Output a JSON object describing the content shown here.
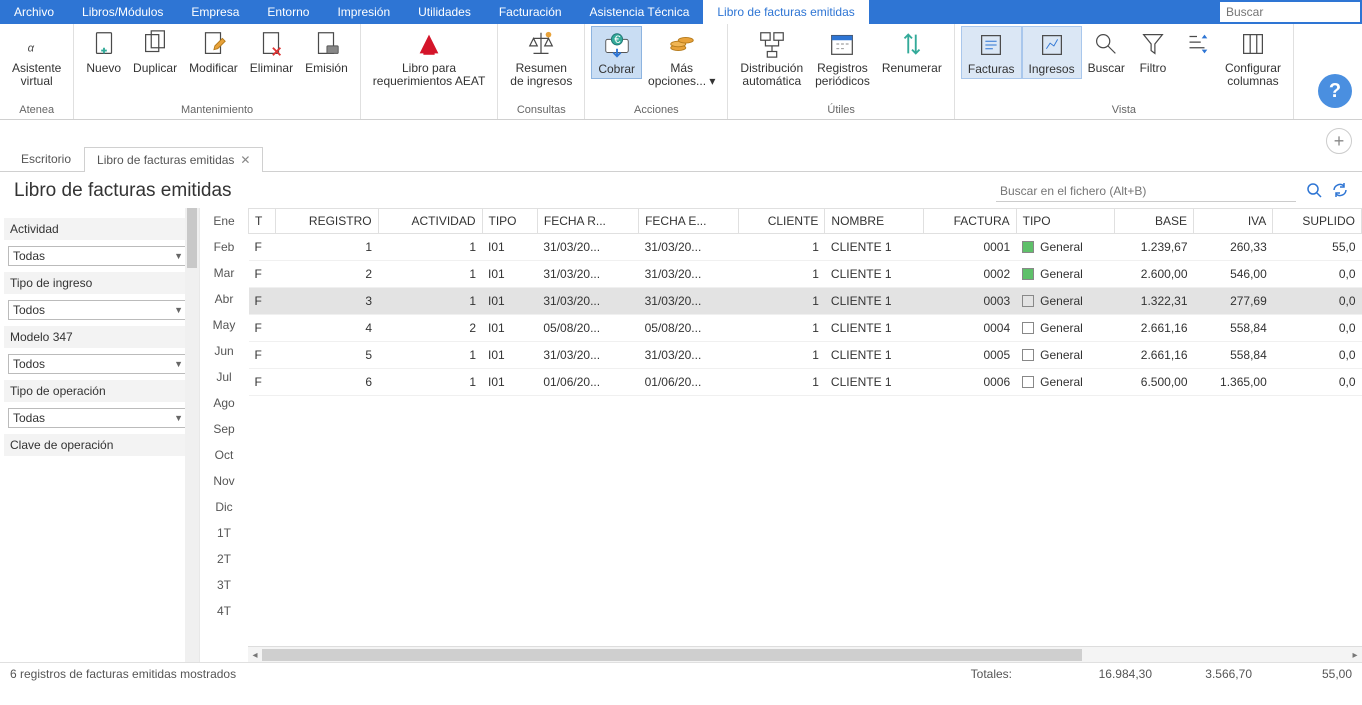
{
  "menu": {
    "items": [
      "Archivo",
      "Libros/Módulos",
      "Empresa",
      "Entorno",
      "Impresión",
      "Utilidades",
      "Facturación",
      "Asistencia Técnica",
      "Libro de facturas emitidas"
    ],
    "active": 8,
    "search_placeholder": "Buscar"
  },
  "ribbon": {
    "groups": [
      {
        "title": "Atenea",
        "buttons": [
          {
            "label": "Asistente\nvirtual",
            "icon": "alpha"
          }
        ]
      },
      {
        "title": "Mantenimiento",
        "buttons": [
          {
            "label": "Nuevo",
            "icon": "doc-plus"
          },
          {
            "label": "Duplicar",
            "icon": "doc-dup"
          },
          {
            "label": "Modificar",
            "icon": "doc-edit"
          },
          {
            "label": "Eliminar",
            "icon": "doc-del"
          },
          {
            "label": "Emisión",
            "icon": "doc-print"
          }
        ]
      },
      {
        "title": "",
        "buttons": [
          {
            "label": "Libro para\nrequerimientos AEAT",
            "icon": "aeat"
          }
        ]
      },
      {
        "title": "Consultas",
        "buttons": [
          {
            "label": "Resumen\nde ingresos",
            "icon": "scales"
          }
        ]
      },
      {
        "title": "Acciones",
        "buttons": [
          {
            "label": "Cobrar",
            "icon": "pay",
            "hl": true
          },
          {
            "label": "Más\nopciones... ▾",
            "icon": "coins"
          }
        ]
      },
      {
        "title": "Útiles",
        "buttons": [
          {
            "label": "Distribución\nautomática",
            "icon": "dist"
          },
          {
            "label": "Registros\nperiódicos",
            "icon": "cal"
          },
          {
            "label": "Renumerar",
            "icon": "renum"
          }
        ]
      },
      {
        "title": "Vista",
        "buttons": [
          {
            "label": "Facturas",
            "icon": "inv",
            "sel": true
          },
          {
            "label": "Ingresos",
            "icon": "inc",
            "sel": true
          },
          {
            "label": "Buscar",
            "icon": "find"
          },
          {
            "label": "Filtro",
            "icon": "filter"
          },
          {
            "label": "",
            "icon": "sort"
          },
          {
            "label": "Configurar\ncolumnas",
            "icon": "cols"
          }
        ]
      }
    ]
  },
  "tabs": [
    {
      "label": "Escritorio"
    },
    {
      "label": "Libro de facturas emitidas",
      "close": true,
      "active": true
    }
  ],
  "page": {
    "title": "Libro de facturas emitidas",
    "search_placeholder": "Buscar en el fichero (Alt+B)"
  },
  "filters": [
    {
      "label": "Actividad",
      "value": "Todas"
    },
    {
      "label": "Tipo de ingreso",
      "value": "Todos"
    },
    {
      "label": "Modelo 347",
      "value": "Todos"
    },
    {
      "label": "Tipo de operación",
      "value": "Todas"
    },
    {
      "label": "Clave de operación",
      "value": ""
    }
  ],
  "months": [
    "Ene",
    "Feb",
    "Mar",
    "Abr",
    "May",
    "Jun",
    "Jul",
    "Ago",
    "Sep",
    "Oct",
    "Nov",
    "Dic",
    "1T",
    "2T",
    "3T",
    "4T"
  ],
  "grid": {
    "columns": [
      "T",
      "REGISTRO",
      "ACTIVIDAD",
      "TIPO",
      "FECHA R...",
      "FECHA E...",
      "CLIENTE",
      "NOMBRE",
      "FACTURA",
      "TIPO",
      "BASE",
      "IVA",
      "SUPLIDO"
    ],
    "rows": [
      {
        "t": "F",
        "reg": "1",
        "act": "1",
        "tipo": "I01",
        "fr": "31/03/20...",
        "fe": "31/03/20...",
        "cli": "1",
        "nom": "CLIENTE 1",
        "fac": "0001",
        "tt": "General",
        "tg": true,
        "base": "1.239,67",
        "iva": "260,33",
        "sup": "55,0"
      },
      {
        "t": "F",
        "reg": "2",
        "act": "1",
        "tipo": "I01",
        "fr": "31/03/20...",
        "fe": "31/03/20...",
        "cli": "1",
        "nom": "CLIENTE 1",
        "fac": "0002",
        "tt": "General",
        "tg": true,
        "base": "2.600,00",
        "iva": "546,00",
        "sup": "0,0"
      },
      {
        "t": "F",
        "reg": "3",
        "act": "1",
        "tipo": "I01",
        "fr": "31/03/20...",
        "fe": "31/03/20...",
        "cli": "1",
        "nom": "CLIENTE 1",
        "fac": "0003",
        "tt": "General",
        "tg": false,
        "base": "1.322,31",
        "iva": "277,69",
        "sup": "0,0",
        "sel": true
      },
      {
        "t": "F",
        "reg": "4",
        "act": "2",
        "tipo": "I01",
        "fr": "05/08/20...",
        "fe": "05/08/20...",
        "cli": "1",
        "nom": "CLIENTE 1",
        "fac": "0004",
        "tt": "General",
        "tg": false,
        "base": "2.661,16",
        "iva": "558,84",
        "sup": "0,0"
      },
      {
        "t": "F",
        "reg": "5",
        "act": "1",
        "tipo": "I01",
        "fr": "31/03/20...",
        "fe": "31/03/20...",
        "cli": "1",
        "nom": "CLIENTE 1",
        "fac": "0005",
        "tt": "General",
        "tg": false,
        "base": "2.661,16",
        "iva": "558,84",
        "sup": "0,0"
      },
      {
        "t": "F",
        "reg": "6",
        "act": "1",
        "tipo": "I01",
        "fr": "01/06/20...",
        "fe": "01/06/20...",
        "cli": "1",
        "nom": "CLIENTE 1",
        "fac": "0006",
        "tt": "General",
        "tg": false,
        "base": "6.500,00",
        "iva": "1.365,00",
        "sup": "0,0"
      }
    ]
  },
  "status": {
    "count": "6 registros de facturas emitidas mostrados",
    "totales_label": "Totales:",
    "base": "16.984,30",
    "iva": "3.566,70",
    "sup": "55,00"
  }
}
